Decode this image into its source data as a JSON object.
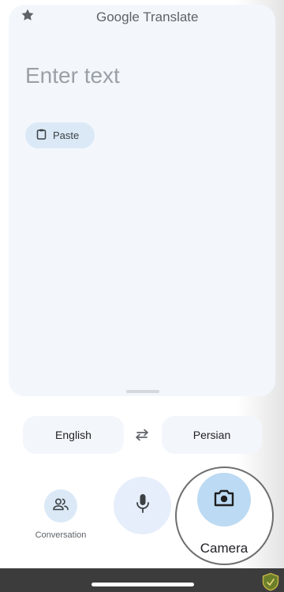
{
  "header": {
    "brand": "Google",
    "product": "Translate",
    "star_icon": "star-icon"
  },
  "input": {
    "placeholder": "Enter text",
    "value": ""
  },
  "paste": {
    "label": "Paste",
    "icon": "clipboard-icon"
  },
  "languages": {
    "source": "English",
    "target": "Persian",
    "swap_icon": "swap-arrows-icon"
  },
  "actions": {
    "conversation_label": "Conversation",
    "conversation_icon": "people-icon",
    "mic_icon": "microphone-icon",
    "camera_label": "Camera",
    "camera_icon": "camera-icon"
  },
  "colors": {
    "accent": "#bcdaf3",
    "card_bg": "#f3f7fc",
    "chip_bg": "#dbe9f7",
    "nav_bar": "#3c3c3c"
  }
}
